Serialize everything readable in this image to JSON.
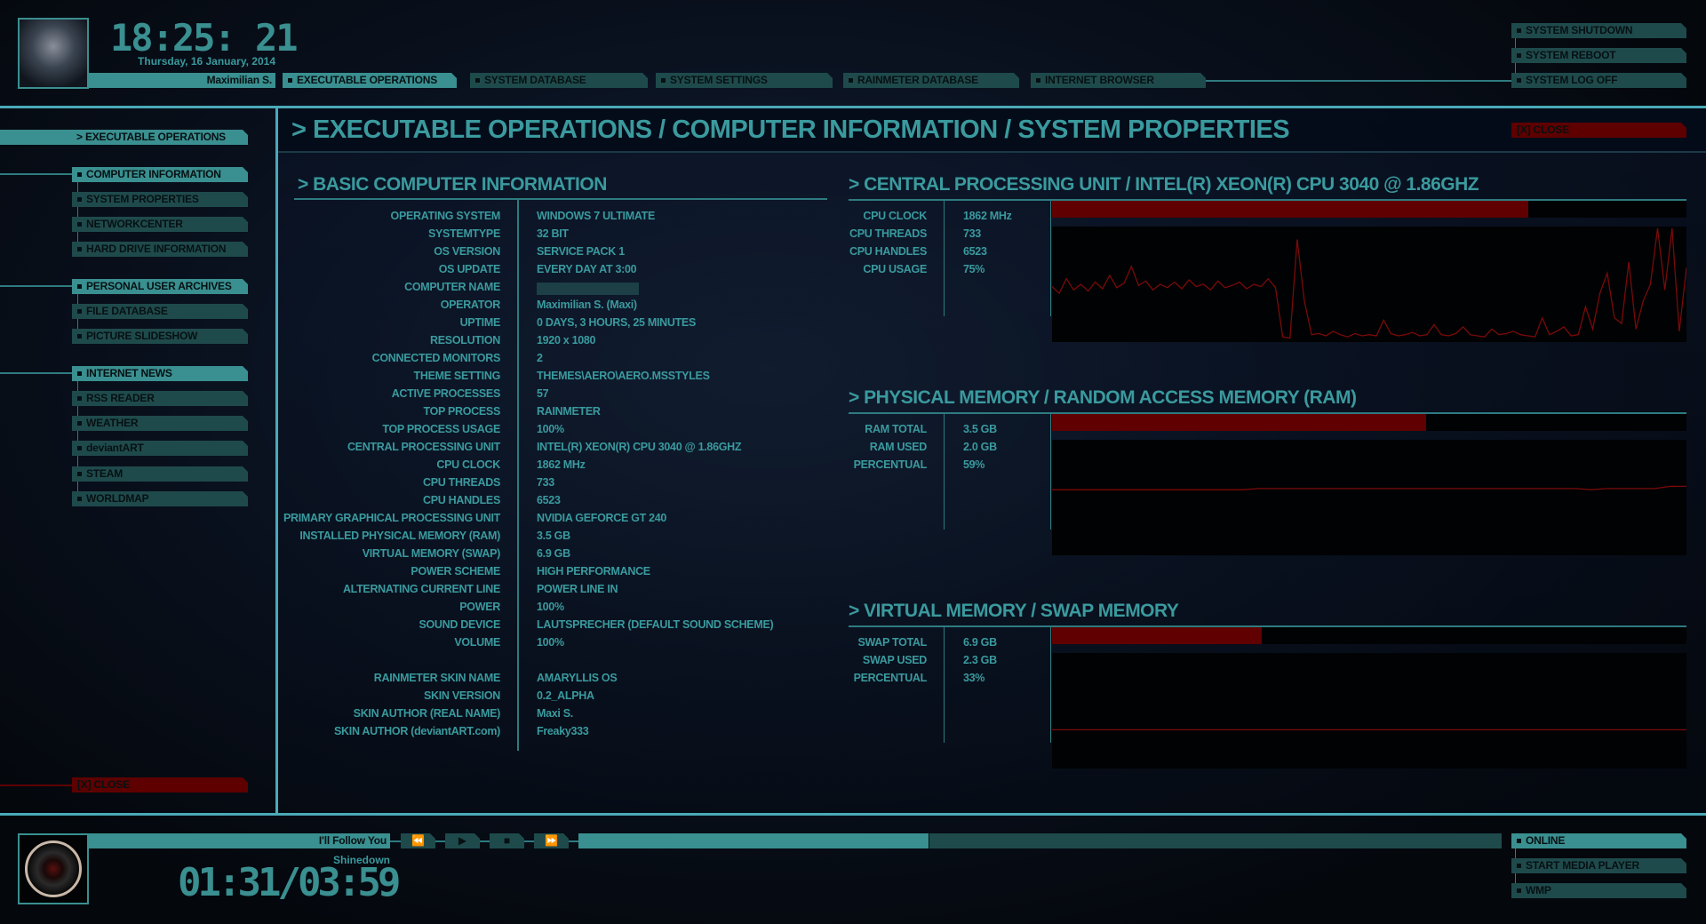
{
  "header": {
    "clock": "18:25: 21",
    "date": "Thursday, 16 January, 2014",
    "user": "Maximilian S.",
    "tabs": [
      "EXECUTABLE OPERATIONS",
      "SYSTEM DATABASE",
      "SYSTEM SETTINGS",
      "RAINMETER DATABASE",
      "INTERNET BROWSER"
    ],
    "power": [
      "SYSTEM SHUTDOWN",
      "SYSTEM REBOOT",
      "SYSTEM LOG OFF"
    ]
  },
  "sidebar": {
    "header": "> EXECUTABLE OPERATIONS",
    "groups": [
      {
        "items": [
          "COMPUTER INFORMATION",
          "SYSTEM PROPERTIES",
          "NETWORKCENTER",
          "HARD DRIVE INFORMATION"
        ]
      },
      {
        "items": [
          "PERSONAL USER ARCHIVES",
          "FILE DATABASE",
          "PICTURE SLIDESHOW"
        ]
      },
      {
        "items": [
          "INTERNET NEWS",
          "RSS READER",
          "WEATHER",
          "deviantART",
          "STEAM",
          "WORLDMAP"
        ]
      }
    ],
    "close": "[X] CLOSE"
  },
  "main": {
    "title": "> EXECUTABLE OPERATIONS / COMPUTER INFORMATION / SYSTEM PROPERTIES",
    "close": "[X] CLOSE",
    "basic": {
      "heading": "> BASIC COMPUTER INFORMATION",
      "rows": [
        [
          "OPERATING SYSTEM",
          "WINDOWS 7 ULTIMATE"
        ],
        [
          "SYSTEMTYPE",
          "32 BIT"
        ],
        [
          "OS VERSION",
          "SERVICE PACK 1"
        ],
        [
          "OS UPDATE",
          "EVERY DAY AT 3:00"
        ],
        [
          "COMPUTER NAME",
          ""
        ],
        [
          "OPERATOR",
          "Maximilian S. (Maxi)"
        ],
        [
          "UPTIME",
          "0 DAYS, 3 HOURS, 25 MINUTES"
        ],
        [
          "RESOLUTION",
          "1920 x 1080"
        ],
        [
          "CONNECTED MONITORS",
          "2"
        ],
        [
          "THEME SETTING",
          "THEMES\\AERO\\AERO.MSSTYLES"
        ],
        [
          "ACTIVE PROCESSES",
          "57"
        ],
        [
          "TOP PROCESS",
          "RAINMETER"
        ],
        [
          "TOP PROCESS USAGE",
          "100%"
        ],
        [
          "CENTRAL PROCESSING UNIT",
          "INTEL(R) XEON(R) CPU          3040  @ 1.86GHZ"
        ],
        [
          "CPU CLOCK",
          "1862 MHz"
        ],
        [
          "CPU THREADS",
          "733"
        ],
        [
          "CPU HANDLES",
          "6523"
        ],
        [
          "PRIMARY GRAPHICAL PROCESSING UNIT",
          "NVIDIA GEFORCE GT 240"
        ],
        [
          "INSTALLED PHYSICAL MEMORY (RAM)",
          "3.5 GB"
        ],
        [
          "VIRTUAL MEMORY (SWAP)",
          "6.9 GB"
        ],
        [
          "POWER SCHEME",
          "HIGH PERFORMANCE"
        ],
        [
          "ALTERNATING CURRENT LINE",
          "POWER LINE IN"
        ],
        [
          "POWER",
          "100%"
        ],
        [
          "SOUND DEVICE",
          "LAUTSPRECHER (DEFAULT SOUND SCHEME)"
        ],
        [
          "VOLUME",
          "100%"
        ]
      ],
      "skin_rows": [
        [
          "RAINMETER SKIN NAME",
          "AMARYLLIS OS"
        ],
        [
          "SKIN VERSION",
          "0.2_ALPHA"
        ],
        [
          "SKIN AUTHOR (REAL NAME)",
          "Maxi S."
        ],
        [
          "SKIN AUTHOR (deviantART.com)",
          "Freaky333"
        ]
      ]
    },
    "cpu": {
      "heading": "> CENTRAL PROCESSING UNIT / INTEL(R) XEON(R) CPU        3040  @ 1.86GHZ",
      "rows": [
        [
          "CPU CLOCK",
          "1862 MHz"
        ],
        [
          "CPU THREADS",
          "733"
        ],
        [
          "CPU HANDLES",
          "6523"
        ],
        [
          "CPU USAGE",
          "75%"
        ]
      ],
      "usage_percent": 75,
      "history": [
        48,
        42,
        55,
        45,
        50,
        44,
        52,
        46,
        58,
        47,
        51,
        66,
        49,
        53,
        45,
        50,
        47,
        52,
        46,
        54,
        48,
        50,
        45,
        53,
        47,
        49,
        52,
        46,
        50,
        48,
        55,
        47,
        3,
        2,
        90,
        35,
        5,
        6,
        4,
        8,
        5,
        3,
        6,
        4,
        5,
        4,
        18,
        6,
        4,
        5,
        7,
        4,
        5,
        14,
        5,
        4,
        6,
        12,
        5,
        4,
        3,
        10,
        5,
        6,
        8,
        5,
        4,
        3,
        20,
        5,
        8,
        12,
        4,
        5,
        30,
        10,
        42,
        60,
        20,
        15,
        70,
        10,
        35,
        50,
        100,
        45,
        100,
        8,
        65
      ]
    },
    "ram": {
      "heading": "> PHYSICAL MEMORY / RANDOM ACCESS MEMORY (RAM)",
      "rows": [
        [
          "RAM TOTAL",
          "3.5 GB"
        ],
        [
          "RAM USED",
          "2.0 GB"
        ],
        [
          "PERCENTUAL",
          "59%"
        ]
      ],
      "usage_percent": 59,
      "history": [
        57,
        57,
        57,
        57,
        57,
        57,
        57,
        57,
        57,
        57,
        57,
        57,
        57,
        58,
        58,
        58,
        58,
        58,
        58,
        58,
        58,
        58,
        58,
        58,
        58,
        58,
        58,
        58,
        58,
        58,
        58,
        58,
        58,
        58,
        57,
        58,
        58,
        58,
        58,
        60,
        60
      ]
    },
    "swap": {
      "heading": "> VIRTUAL MEMORY / SWAP MEMORY",
      "rows": [
        [
          "SWAP TOTAL",
          "6.9 GB"
        ],
        [
          "SWAP USED",
          "2.3 GB"
        ],
        [
          "PERCENTUAL",
          "33%"
        ]
      ],
      "usage_percent": 33,
      "history": [
        33,
        33,
        33,
        33,
        33,
        33,
        33,
        33,
        33,
        33,
        33,
        33,
        33,
        33,
        33,
        33,
        33,
        33,
        33,
        33,
        33,
        33,
        33,
        33,
        33,
        33,
        33,
        33,
        33,
        33,
        33,
        33,
        33,
        33,
        33,
        33,
        33,
        33,
        33,
        33,
        33
      ]
    }
  },
  "player": {
    "track": "I'll Follow You",
    "artist": "Shinedown",
    "time": "01:31/03:59",
    "progress_percent": 38,
    "controls": [
      "⏪",
      "▶",
      "■",
      "⏩"
    ],
    "menu": [
      "ONLINE",
      "START MEDIA PLAYER",
      "WMP"
    ]
  },
  "colors": {
    "accent": "#3a8f90",
    "accent_dark": "#1f4a4c",
    "alert": "#600000"
  }
}
